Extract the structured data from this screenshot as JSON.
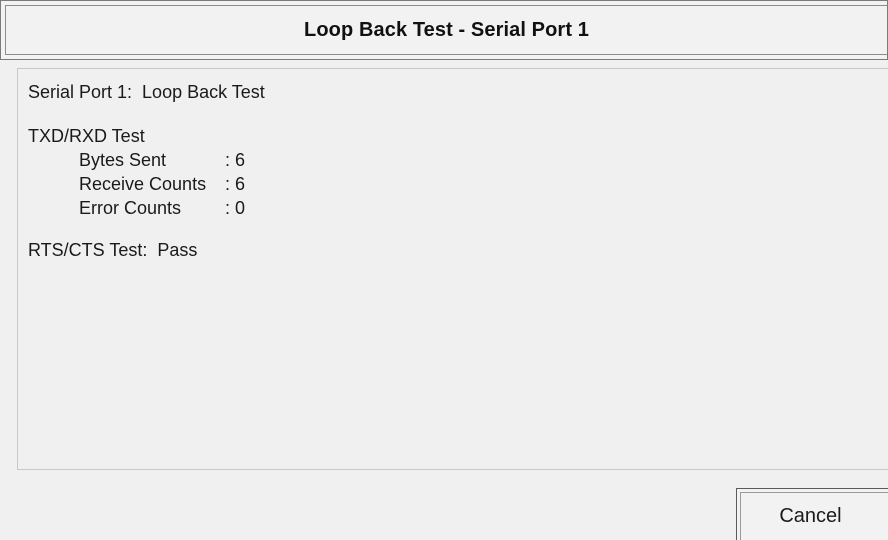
{
  "window": {
    "title": "Loop Back Test - Serial Port 1"
  },
  "report": {
    "heading": "Serial Port 1:  Loop Back Test",
    "txd_rxd_title": "TXD/RXD Test",
    "rows": [
      {
        "label": "Bytes Sent",
        "value": ": 6"
      },
      {
        "label": "Receive Counts",
        "value": ": 6"
      },
      {
        "label": "Error Counts",
        "value": ": 0"
      }
    ],
    "rts_cts_line": "RTS/CTS Test:  Pass"
  },
  "buttons": {
    "cancel_label": "Cancel"
  }
}
